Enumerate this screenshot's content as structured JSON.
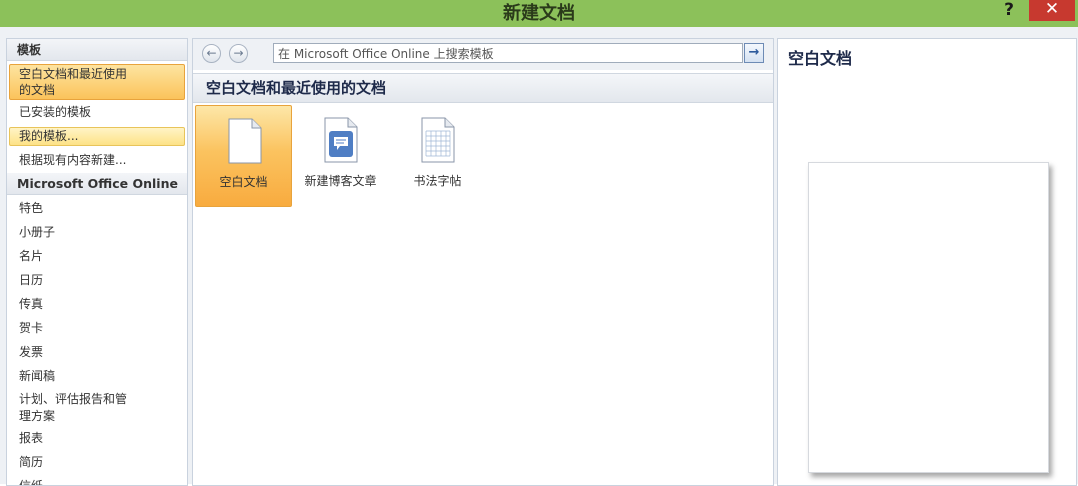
{
  "window": {
    "title": "新建文档",
    "help_label": "?",
    "close_label": "✕"
  },
  "sidebar": {
    "header_templates": "模板",
    "items_top": [
      {
        "label": "空白文档和最近使用\n的文档",
        "state": "selected"
      },
      {
        "label": "已安装的模板",
        "state": "normal"
      },
      {
        "label": "我的模板...",
        "state": "hover"
      },
      {
        "label": "根据现有内容新建...",
        "state": "normal"
      }
    ],
    "header_online": "Microsoft Office Online",
    "items_online": [
      "特色",
      "小册子",
      "名片",
      "日历",
      "传真",
      "贺卡",
      "发票",
      "新闻稿",
      "计划、评估报告和管\n理方案",
      "报表",
      "简历",
      "信纸"
    ]
  },
  "navigation": {
    "back_icon": "arrow-left-icon",
    "forward_icon": "arrow-right-icon",
    "search_value": "在 Microsoft Office Online 上搜索模板",
    "go_icon": "arrow-right-icon"
  },
  "main": {
    "section_title": "空白文档和最近使用的文档",
    "templates": [
      {
        "label": "空白文档",
        "icon": "blank-document-icon",
        "selected": true
      },
      {
        "label": "新建博客文章",
        "icon": "blog-post-icon",
        "selected": false
      },
      {
        "label": "书法字帖",
        "icon": "calligraphy-grid-icon",
        "selected": false
      }
    ]
  },
  "preview": {
    "title": "空白文档"
  },
  "colors": {
    "titlebar": "#8cc15a",
    "close": "#c7392f",
    "selection": "#fbc35b"
  }
}
